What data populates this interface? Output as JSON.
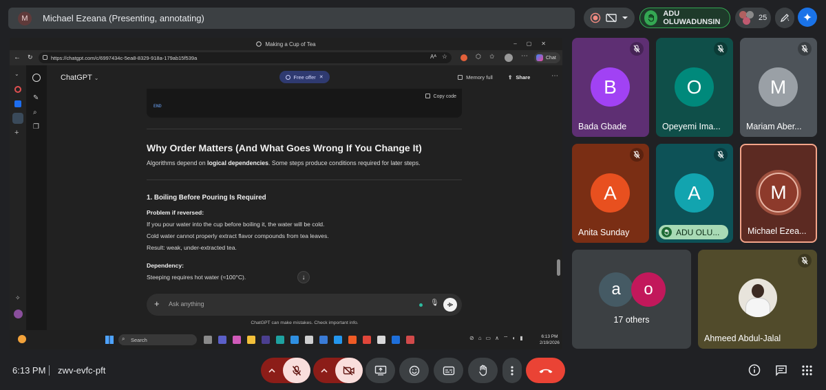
{
  "meet": {
    "presenter_avatar_letter": "M",
    "presenter_label": "Michael Ezeana (Presenting, annotating)",
    "raised_hand_name": "ADU OLUWADUNSIN",
    "participant_count": "25",
    "time": "6:13 PM",
    "meeting_code": "zwv-evfc-pft"
  },
  "browser": {
    "tab_title": "Making a Cup of Tea",
    "url": "https://chatgpt.com/c/6997434c-5ea8-8329-918a-179ab15f539a",
    "chat_label": "Chat"
  },
  "chatgpt": {
    "model_label": "ChatGPT",
    "free_offer": "Free offer",
    "memory_full": "Memory full",
    "share": "Share",
    "copy_code": "Copy code",
    "code_end": "END",
    "section_title": "Why Order Matters (And What Goes Wrong If You Change It)",
    "intro_prefix": "Algorithms depend on ",
    "intro_bold": "logical dependencies",
    "intro_suffix": ". Some steps produce conditions required for later steps.",
    "step_title": "1. Boiling Before Pouring Is Required",
    "problem_label": "Problem if reversed:",
    "problem_lines": [
      "If you pour water into the cup before boiling it, the water will be cold.",
      "Cold water cannot properly extract flavor compounds from tea leaves.",
      "Result: weak, under-extracted tea."
    ],
    "dependency_label": "Dependency:",
    "dependency_line": "Steeping requires hot water (≈100°C).",
    "prompt_placeholder": "Ask anything",
    "disclaimer": "ChatGPT can make mistakes. Check important info."
  },
  "taskbar": {
    "search": "Search",
    "time": "6:13 PM",
    "date": "2/19/2026"
  },
  "tiles": [
    {
      "letter": "B",
      "name": "Bada Gbade"
    },
    {
      "letter": "O",
      "name": "Opeyemi Ima..."
    },
    {
      "letter": "M",
      "name": "Mariam Aber..."
    },
    {
      "letter": "A",
      "name": "Anita Sunday"
    },
    {
      "letter": "A",
      "name": "ADU OLU..."
    },
    {
      "letter": "M",
      "name": "Michael Ezea..."
    },
    {
      "letter_a": "a",
      "letter_b": "o",
      "name": "17 others"
    },
    {
      "name": "Ahmeed Abdul-Jalal"
    }
  ],
  "colors": {
    "raised_hand_green": "#34a853",
    "leave_red": "#ea4335",
    "bada_avatar": "#a142f4",
    "opeyemi_avatar": "#00897b",
    "mariam_avatar": "#9aa0a6",
    "anita_avatar": "#e8501f",
    "adu_avatar": "#12a4af",
    "michael_avatar": "#8d3a2b"
  }
}
